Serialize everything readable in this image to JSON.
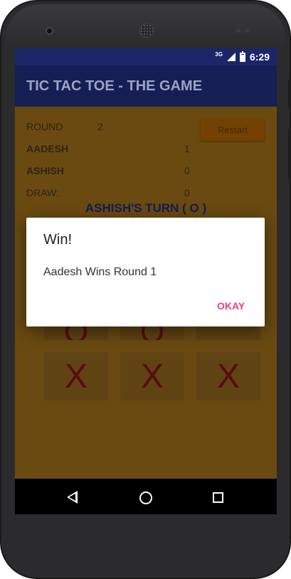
{
  "status_bar": {
    "network": "3G",
    "time": "6:29"
  },
  "app_bar": {
    "title": "TIC TAC TOE - THE GAME"
  },
  "scoreboard": {
    "round_label": "ROUND",
    "round_value": "2",
    "player1_name": "AADESH",
    "player1_score": "1",
    "player2_name": "ASHISH",
    "player2_score": "0",
    "draw_label": "DRAW:",
    "draw_value": "0"
  },
  "restart_label": "Restart",
  "turn_text": "ASHISH'S TURN ( O )",
  "board": {
    "row2": [
      "O",
      "O",
      ""
    ],
    "row3": [
      "X",
      "X",
      "X"
    ]
  },
  "dialog": {
    "title": "Win!",
    "message": "Aadesh Wins Round 1",
    "button_label": "OKAY"
  },
  "colors": {
    "status_bar": "#1a2668",
    "app_bar": "#151f55",
    "board_background": "#6a4a11",
    "mark_color": "#5a0b12",
    "accent": "#f0407a"
  }
}
